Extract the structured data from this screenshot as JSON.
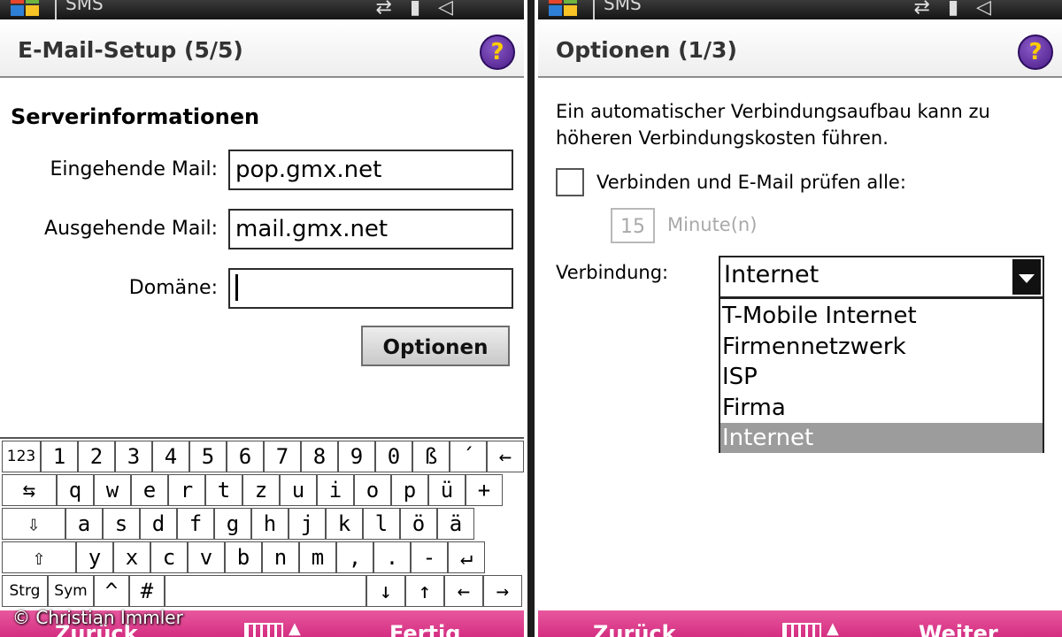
{
  "left": {
    "status_title": "SMS",
    "title": "E-Mail-Setup (5/5)",
    "help_symbol": "?",
    "section_title": "Serverinformationen",
    "incoming_label": "Eingehende Mail:",
    "incoming_value": "pop.gmx.net",
    "outgoing_label": "Ausgehende Mail:",
    "outgoing_value": "mail.gmx.net",
    "domain_label": "Domäne:",
    "domain_value": "",
    "options_button": "Optionen",
    "softkey_left": "Zurück",
    "softkey_right": "Fertig"
  },
  "keyboard": {
    "row1": [
      "123",
      "1",
      "2",
      "3",
      "4",
      "5",
      "6",
      "7",
      "8",
      "9",
      "0",
      "ß",
      "´",
      "←"
    ],
    "row2": [
      "⇆",
      "q",
      "w",
      "e",
      "r",
      "t",
      "z",
      "u",
      "i",
      "o",
      "p",
      "ü",
      "+"
    ],
    "row3": [
      "⇩",
      "a",
      "s",
      "d",
      "f",
      "g",
      "h",
      "j",
      "k",
      "l",
      "ö",
      "ä"
    ],
    "row4": [
      "⇧",
      "y",
      "x",
      "c",
      "v",
      "b",
      "n",
      "m",
      ",",
      ".",
      "-",
      "↵"
    ],
    "row5": [
      "Strg",
      "Sym",
      "^",
      "#",
      "",
      "↓",
      "↑",
      "←",
      "→"
    ]
  },
  "right": {
    "status_title": "SMS",
    "title": "Optionen (1/3)",
    "help_symbol": "?",
    "info_line1": "Ein automatischer Verbindungsaufbau kann zu",
    "info_line2": "höheren Verbindungskosten führen.",
    "check_label": "Verbinden und E-Mail prüfen alle:",
    "check_checked": false,
    "minutes_value": "15",
    "minutes_label": "Minute(n)",
    "connection_label": "Verbindung:",
    "connection_selected": "Internet",
    "connection_options": [
      "T-Mobile Internet",
      "Firmennetzwerk",
      "ISP",
      "Firma",
      "Internet"
    ],
    "softkey_left": "Zurück",
    "softkey_right": "Weiter"
  },
  "copyright": "© Christian Immler",
  "colors": {
    "softkey_bar": "#d42e82",
    "dropdown_highlight": "#9c9c9c",
    "help_icon": "#4a1c86"
  }
}
